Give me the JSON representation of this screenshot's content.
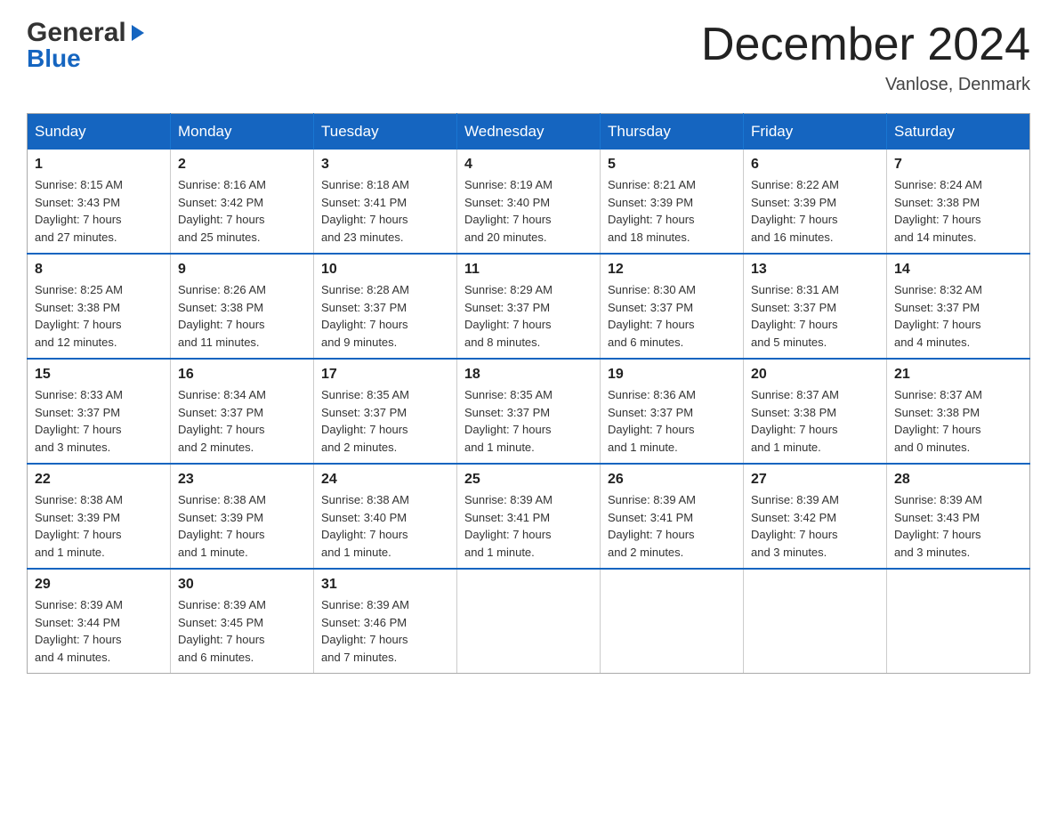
{
  "logo": {
    "line1": "General",
    "arrow": "▶",
    "line2": "Blue"
  },
  "title": "December 2024",
  "subtitle": "Vanlose, Denmark",
  "weekdays": [
    "Sunday",
    "Monday",
    "Tuesday",
    "Wednesday",
    "Thursday",
    "Friday",
    "Saturday"
  ],
  "weeks": [
    [
      {
        "day": "1",
        "sunrise": "8:15 AM",
        "sunset": "3:43 PM",
        "daylight": "7 hours and 27 minutes."
      },
      {
        "day": "2",
        "sunrise": "8:16 AM",
        "sunset": "3:42 PM",
        "daylight": "7 hours and 25 minutes."
      },
      {
        "day": "3",
        "sunrise": "8:18 AM",
        "sunset": "3:41 PM",
        "daylight": "7 hours and 23 minutes."
      },
      {
        "day": "4",
        "sunrise": "8:19 AM",
        "sunset": "3:40 PM",
        "daylight": "7 hours and 20 minutes."
      },
      {
        "day": "5",
        "sunrise": "8:21 AM",
        "sunset": "3:39 PM",
        "daylight": "7 hours and 18 minutes."
      },
      {
        "day": "6",
        "sunrise": "8:22 AM",
        "sunset": "3:39 PM",
        "daylight": "7 hours and 16 minutes."
      },
      {
        "day": "7",
        "sunrise": "8:24 AM",
        "sunset": "3:38 PM",
        "daylight": "7 hours and 14 minutes."
      }
    ],
    [
      {
        "day": "8",
        "sunrise": "8:25 AM",
        "sunset": "3:38 PM",
        "daylight": "7 hours and 12 minutes."
      },
      {
        "day": "9",
        "sunrise": "8:26 AM",
        "sunset": "3:38 PM",
        "daylight": "7 hours and 11 minutes."
      },
      {
        "day": "10",
        "sunrise": "8:28 AM",
        "sunset": "3:37 PM",
        "daylight": "7 hours and 9 minutes."
      },
      {
        "day": "11",
        "sunrise": "8:29 AM",
        "sunset": "3:37 PM",
        "daylight": "7 hours and 8 minutes."
      },
      {
        "day": "12",
        "sunrise": "8:30 AM",
        "sunset": "3:37 PM",
        "daylight": "7 hours and 6 minutes."
      },
      {
        "day": "13",
        "sunrise": "8:31 AM",
        "sunset": "3:37 PM",
        "daylight": "7 hours and 5 minutes."
      },
      {
        "day": "14",
        "sunrise": "8:32 AM",
        "sunset": "3:37 PM",
        "daylight": "7 hours and 4 minutes."
      }
    ],
    [
      {
        "day": "15",
        "sunrise": "8:33 AM",
        "sunset": "3:37 PM",
        "daylight": "7 hours and 3 minutes."
      },
      {
        "day": "16",
        "sunrise": "8:34 AM",
        "sunset": "3:37 PM",
        "daylight": "7 hours and 2 minutes."
      },
      {
        "day": "17",
        "sunrise": "8:35 AM",
        "sunset": "3:37 PM",
        "daylight": "7 hours and 2 minutes."
      },
      {
        "day": "18",
        "sunrise": "8:35 AM",
        "sunset": "3:37 PM",
        "daylight": "7 hours and 1 minute."
      },
      {
        "day": "19",
        "sunrise": "8:36 AM",
        "sunset": "3:37 PM",
        "daylight": "7 hours and 1 minute."
      },
      {
        "day": "20",
        "sunrise": "8:37 AM",
        "sunset": "3:38 PM",
        "daylight": "7 hours and 1 minute."
      },
      {
        "day": "21",
        "sunrise": "8:37 AM",
        "sunset": "3:38 PM",
        "daylight": "7 hours and 0 minutes."
      }
    ],
    [
      {
        "day": "22",
        "sunrise": "8:38 AM",
        "sunset": "3:39 PM",
        "daylight": "7 hours and 1 minute."
      },
      {
        "day": "23",
        "sunrise": "8:38 AM",
        "sunset": "3:39 PM",
        "daylight": "7 hours and 1 minute."
      },
      {
        "day": "24",
        "sunrise": "8:38 AM",
        "sunset": "3:40 PM",
        "daylight": "7 hours and 1 minute."
      },
      {
        "day": "25",
        "sunrise": "8:39 AM",
        "sunset": "3:41 PM",
        "daylight": "7 hours and 1 minute."
      },
      {
        "day": "26",
        "sunrise": "8:39 AM",
        "sunset": "3:41 PM",
        "daylight": "7 hours and 2 minutes."
      },
      {
        "day": "27",
        "sunrise": "8:39 AM",
        "sunset": "3:42 PM",
        "daylight": "7 hours and 3 minutes."
      },
      {
        "day": "28",
        "sunrise": "8:39 AM",
        "sunset": "3:43 PM",
        "daylight": "7 hours and 3 minutes."
      }
    ],
    [
      {
        "day": "29",
        "sunrise": "8:39 AM",
        "sunset": "3:44 PM",
        "daylight": "7 hours and 4 minutes."
      },
      {
        "day": "30",
        "sunrise": "8:39 AM",
        "sunset": "3:45 PM",
        "daylight": "7 hours and 6 minutes."
      },
      {
        "day": "31",
        "sunrise": "8:39 AM",
        "sunset": "3:46 PM",
        "daylight": "7 hours and 7 minutes."
      },
      null,
      null,
      null,
      null
    ]
  ],
  "labels": {
    "sunrise": "Sunrise:",
    "sunset": "Sunset:",
    "daylight": "Daylight:"
  }
}
